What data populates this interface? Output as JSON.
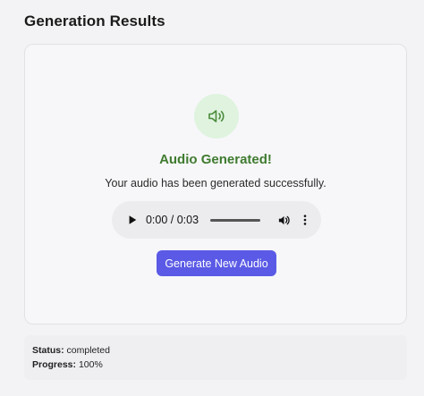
{
  "page": {
    "title": "Generation Results"
  },
  "result": {
    "icon": "speaker-icon",
    "heading": "Audio Generated!",
    "message": "Your audio has been generated successfully.",
    "accent_color": "#3f7b2f"
  },
  "player": {
    "time_display": "0:00 / 0:03",
    "current_time": "0:00",
    "duration": "0:03",
    "progress_fraction": 0
  },
  "actions": {
    "generate_new_label": "Generate New Audio",
    "button_color": "#5a5ae6"
  },
  "status": {
    "status_label": "Status:",
    "status_value": "completed",
    "progress_label": "Progress:",
    "progress_value": "100%"
  }
}
